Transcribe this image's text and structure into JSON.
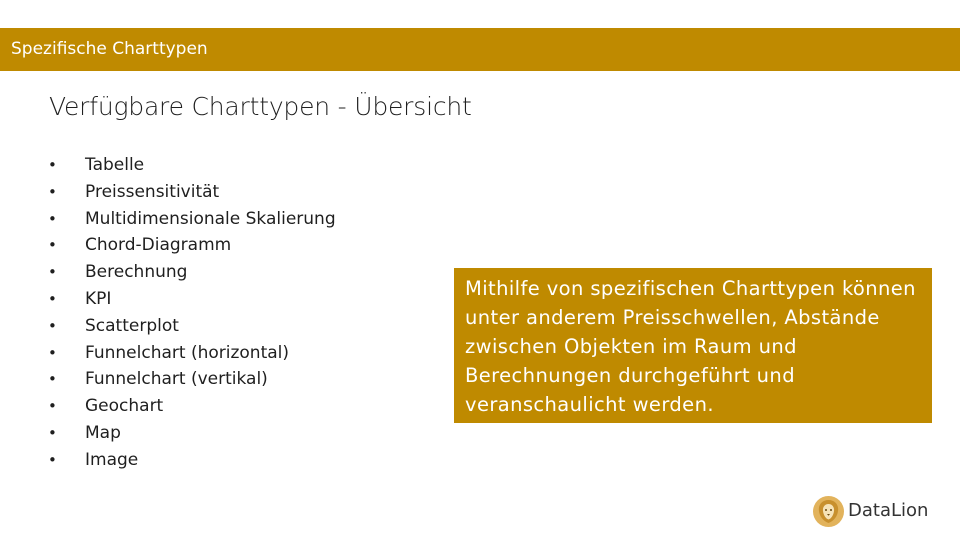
{
  "header": {
    "title": "Spezifische Charttypen"
  },
  "slide": {
    "title": "Verfügbare Charttypen - Übersicht"
  },
  "bullets": [
    "Tabelle",
    "Preissensitivität",
    "Multidimensionale Skalierung",
    "Chord-Diagramm",
    "Berechnung",
    "KPI",
    "Scatterplot",
    "Funnelchart (horizontal)",
    "Funnelchart (vertikal)",
    "Geochart",
    "Map",
    "Image"
  ],
  "callout": {
    "text": "Mithilfe von spezifischen Charttypen können unter anderem Preisschwellen, Abstände zwischen Objekten im Raum und Berechnungen durchgeführt und veranschaulicht werden."
  },
  "logo": {
    "text": "DataLion",
    "icon": "lion-head-icon"
  },
  "colors": {
    "accent": "#BF8A00",
    "logo_badge": "#E2B35C"
  }
}
